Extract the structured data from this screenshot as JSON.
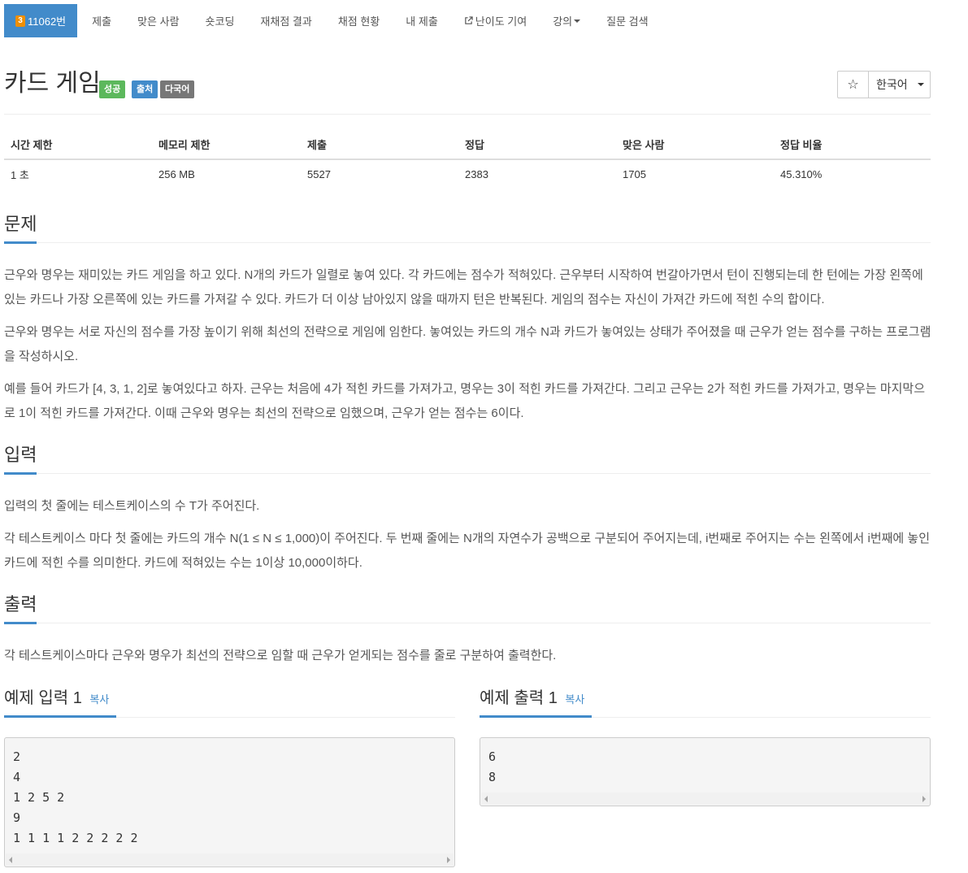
{
  "nav": {
    "problem_id": "11062번",
    "tier_icon": "bronze-tier-icon",
    "items": [
      "제출",
      "맞은 사람",
      "숏코딩",
      "재채점 결과",
      "채점 현황",
      "내 제출",
      "난이도 기여",
      "강의",
      "질문 검색"
    ]
  },
  "title": {
    "text": "카드 게임",
    "labels": [
      "성공",
      "출처",
      "다국어"
    ],
    "star": "☆",
    "lang": "한국어"
  },
  "stats": {
    "headers": [
      "시간 제한",
      "메모리 제한",
      "제출",
      "정답",
      "맞은 사람",
      "정답 비율"
    ],
    "values": [
      "1 초",
      "256 MB",
      "5527",
      "2383",
      "1705",
      "45.310%"
    ]
  },
  "problem": {
    "heading": "문제",
    "p1": "근우와 명우는 재미있는 카드 게임을 하고 있다. N개의 카드가 일렬로 놓여 있다. 각 카드에는 점수가 적혀있다. 근우부터 시작하여 번갈아가면서 턴이 진행되는데 한 턴에는 가장 왼쪽에 있는 카드나 가장 오른쪽에 있는 카드를 가져갈 수 있다. 카드가 더 이상 남아있지 않을 때까지 턴은 반복된다. 게임의 점수는 자신이 가져간 카드에 적힌 수의 합이다.",
    "p2": "근우와 명우는 서로 자신의 점수를 가장 높이기 위해 최선의 전략으로 게임에 임한다. 놓여있는 카드의 개수 N과 카드가 놓여있는 상태가 주어졌을 때 근우가 얻는 점수를 구하는 프로그램을 작성하시오.",
    "p3": "예를 들어 카드가 [4, 3, 1, 2]로 놓여있다고 하자. 근우는 처음에 4가 적힌 카드를 가져가고, 명우는 3이 적힌 카드를 가져간다. 그리고 근우는 2가 적힌 카드를 가져가고, 명우는 마지막으로 1이 적힌 카드를 가져간다. 이때 근우와 명우는 최선의 전략으로 임했으며, 근우가 얻는 점수는 6이다."
  },
  "input": {
    "heading": "입력",
    "p1": "입력의 첫 줄에는 테스트케이스의 수 T가 주어진다.",
    "p2": "각 테스트케이스 마다 첫 줄에는 카드의 개수 N(1 ≤ N ≤ 1,000)이 주어진다. 두 번째 줄에는 N개의 자연수가 공백으로 구분되어 주어지는데, i번째로 주어지는 수는 왼쪽에서 i번째에 놓인 카드에 적힌 수를 의미한다. 카드에 적혀있는 수는 1이상 10,000이하다."
  },
  "output": {
    "heading": "출력",
    "p1": "각 테스트케이스마다 근우와 명우가 최선의 전략으로 임할 때 근우가 얻게되는 점수를 줄로 구분하여 출력한다."
  },
  "samples": {
    "input_title": "예제 입력 1",
    "output_title": "예제 출력 1",
    "copy": "복사",
    "input_text": "2\n4\n1 2 5 2\n9\n1 1 1 1 2 2 2 2 2",
    "output_text": "6\n8"
  },
  "colors": {
    "primary": "#428bca",
    "success": "#5cb85c",
    "default": "#777777",
    "tier": "#ef8f00"
  }
}
